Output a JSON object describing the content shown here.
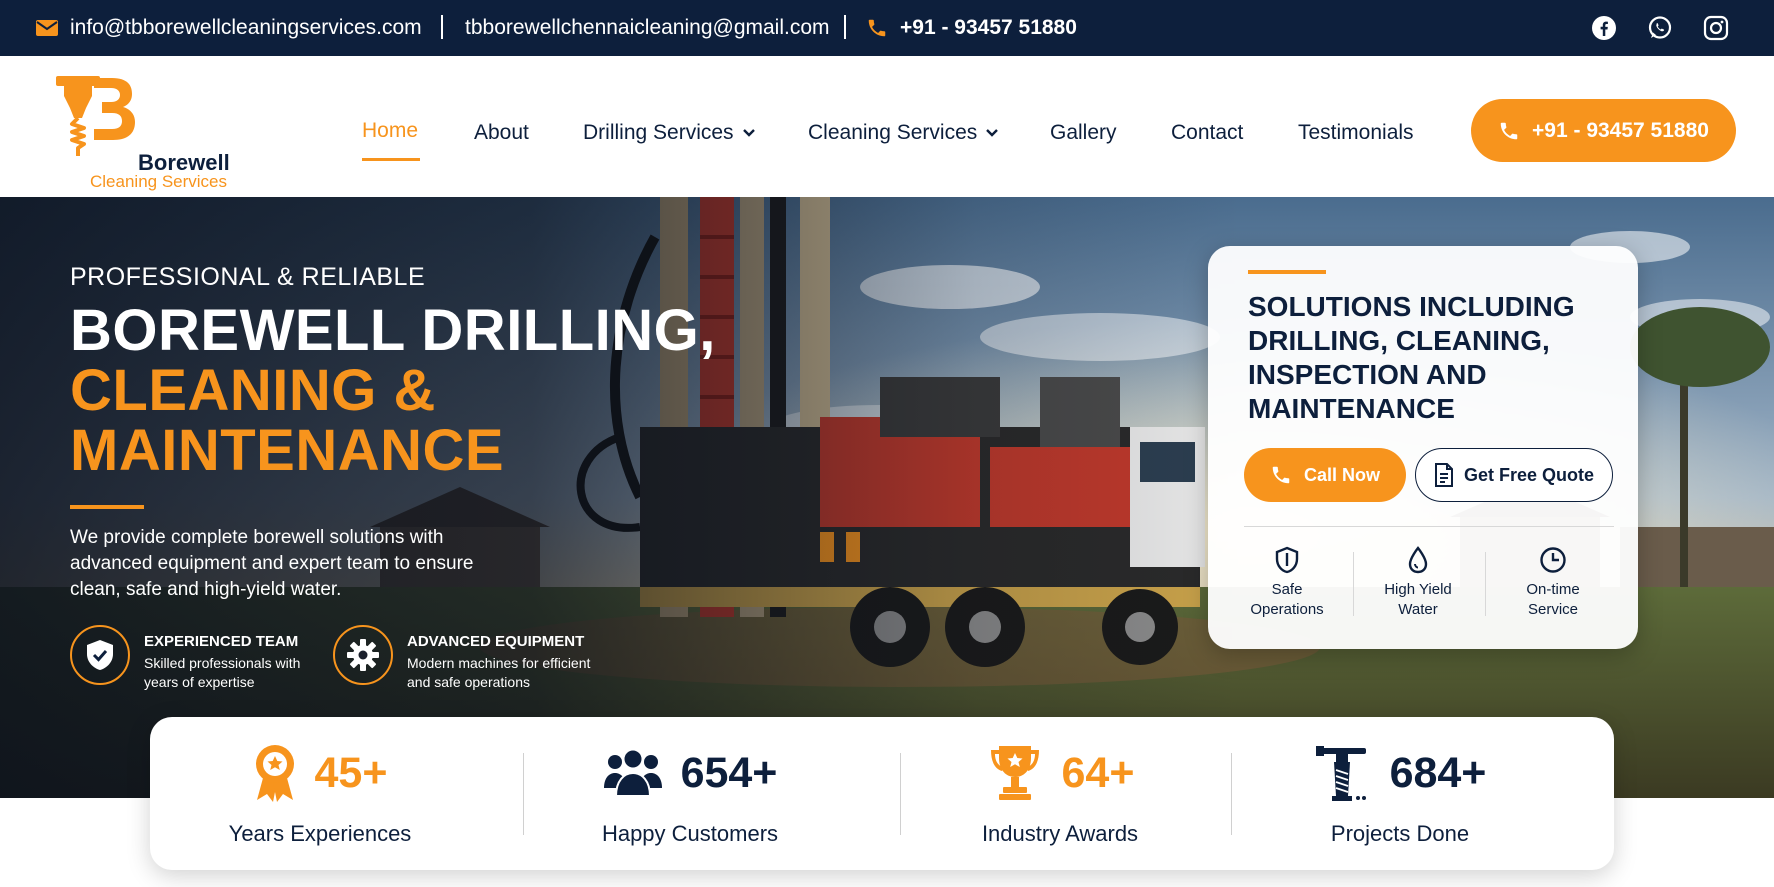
{
  "topbar": {
    "email1": "info@tbborewellcleaningservices.com",
    "email2": "tbborewellchennaicleaning@gmail.com",
    "phone": "+91 - 93457 51880",
    "social": [
      "facebook-icon",
      "whatsapp-icon",
      "instagram-icon"
    ]
  },
  "brand": {
    "line1": "Borewell",
    "line2": "Cleaning Services"
  },
  "nav": {
    "items": [
      {
        "label": "Home",
        "active": true
      },
      {
        "label": "About"
      },
      {
        "label": "Drilling Services",
        "dropdown": true
      },
      {
        "label": "Cleaning Services",
        "dropdown": true
      },
      {
        "label": "Gallery"
      },
      {
        "label": "Contact"
      },
      {
        "label": "Testimonials"
      }
    ],
    "cta": "+91 - 93457 51880"
  },
  "hero": {
    "kicker": "PROFESSIONAL & RELIABLE",
    "title_white": "BOREWELL DRILLING,",
    "title_orange1": "CLEANING &",
    "title_orange2": "MAINTENANCE",
    "description": "We provide complete borewell solutions with advanced equipment and expert team to ensure clean, safe and high-yield water.",
    "features": [
      {
        "icon": "shield-check-icon",
        "title": "EXPERIENCED TEAM",
        "desc": "Skilled professionals with years of expertise"
      },
      {
        "icon": "gear-icon",
        "title": "ADVANCED EQUIPMENT",
        "desc": "Modern machines for efficient and safe operations"
      }
    ]
  },
  "card": {
    "title": "SOLUTIONS INCLUDING DRILLING, CLEANING, INSPECTION AND MAINTENANCE",
    "call_label": "Call Now",
    "quote_label": "Get Free Quote",
    "features": [
      {
        "icon": "shield-icon",
        "label1": "Safe",
        "label2": "Operations"
      },
      {
        "icon": "water-drop-icon",
        "label1": "High Yield",
        "label2": "Water"
      },
      {
        "icon": "clock-icon",
        "label1": "On-time",
        "label2": "Service"
      }
    ]
  },
  "stats": [
    {
      "icon": "award-ribbon-icon",
      "value": "45+",
      "label": "Years Experiences",
      "color": "#f7941d"
    },
    {
      "icon": "users-icon",
      "value": "654+",
      "label": "Happy Customers",
      "color": "#0d1f3c"
    },
    {
      "icon": "trophy-icon",
      "value": "64+",
      "label": "Industry Awards",
      "color": "#f7941d"
    },
    {
      "icon": "drill-icon",
      "value": "684+",
      "label": "Projects Done",
      "color": "#0d1f3c"
    }
  ],
  "colors": {
    "navy": "#0d1f3c",
    "orange": "#f7941d"
  }
}
